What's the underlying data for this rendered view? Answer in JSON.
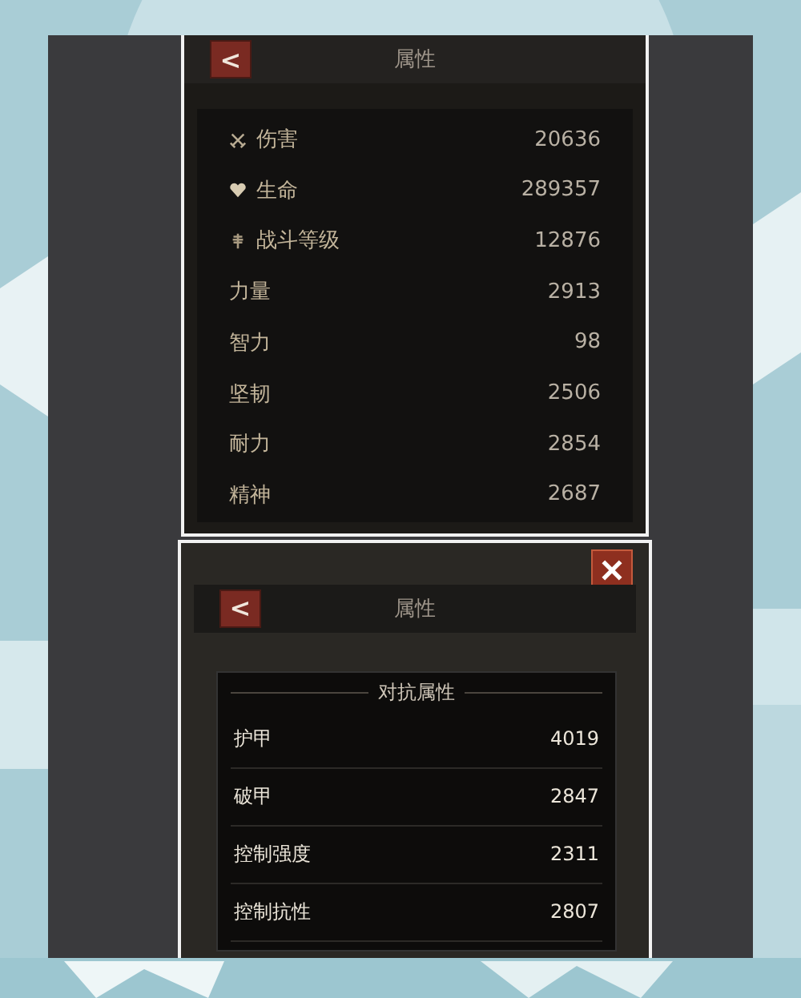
{
  "panel_1": {
    "back_button": "<",
    "title": "属性",
    "stats": [
      {
        "kind": "swords",
        "label": "伤害",
        "value": "20636"
      },
      {
        "kind": "heart",
        "label": "生命",
        "value": "289357"
      },
      {
        "kind": "emblem",
        "label": "战斗等级",
        "value": "12876"
      },
      {
        "kind": "plain",
        "label": "力量",
        "value": "2913"
      },
      {
        "kind": "plain",
        "label": "智力",
        "value": "98"
      },
      {
        "kind": "plain",
        "label": "坚韧",
        "value": "2506"
      },
      {
        "kind": "plain",
        "label": "耐力",
        "value": "2854"
      },
      {
        "kind": "plain",
        "label": "精神",
        "value": "2687"
      }
    ]
  },
  "panel_2": {
    "back_button": "<",
    "title": "属性",
    "section_title": "对抗属性",
    "stats": [
      {
        "label": "护甲",
        "value": "4019"
      },
      {
        "label": "破甲",
        "value": "2847"
      },
      {
        "label": "控制强度",
        "value": "2311"
      },
      {
        "label": "控制抗性",
        "value": "2807"
      }
    ]
  }
}
